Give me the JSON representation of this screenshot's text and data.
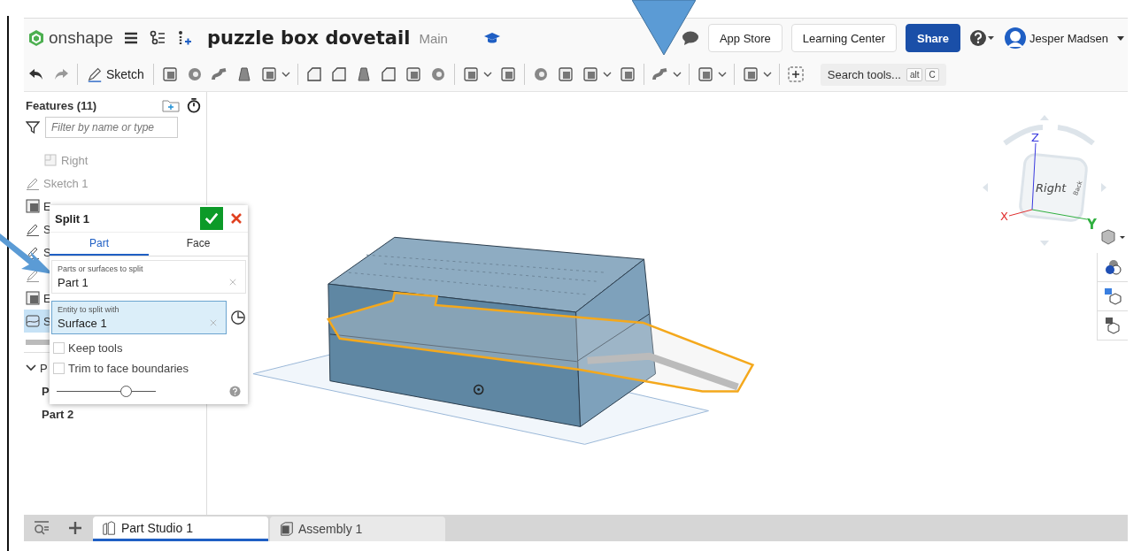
{
  "app": {
    "logo_text": "onshape"
  },
  "document": {
    "title": "puzzle box dovetail",
    "branch": "Main"
  },
  "header_buttons": [
    {
      "label": "App Store",
      "kind": "plain"
    },
    {
      "label": "Learning Center",
      "kind": "plain"
    },
    {
      "label": "Share",
      "kind": "primary"
    }
  ],
  "user": {
    "name": "Jesper Madsen"
  },
  "toolbar": {
    "sketch_label": "Sketch",
    "search": {
      "placeholder": "Search tools...",
      "keys": [
        "alt",
        "C"
      ]
    }
  },
  "features": {
    "title": "Features (11)",
    "filter_placeholder": "Filter by name or type",
    "items": [
      {
        "label": "Right",
        "kind": "plane",
        "hidden": true,
        "selected": false
      },
      {
        "label": "Sketch 1",
        "kind": "sketch",
        "hidden": true,
        "selected": false
      },
      {
        "label": "E",
        "kind": "extrude",
        "hidden": false,
        "selected": false
      },
      {
        "label": "S",
        "kind": "sketch",
        "hidden": false,
        "selected": false
      },
      {
        "label": "S",
        "kind": "sketch",
        "hidden": false,
        "selected": false
      },
      {
        "kind": "sketch",
        "hidden": true,
        "selected": false
      },
      {
        "label": "E",
        "kind": "extrude",
        "hidden": false,
        "selected": false
      },
      {
        "label": "S",
        "kind": "split",
        "hidden": false,
        "selected": true
      }
    ],
    "parts": {
      "label": "P",
      "expanded": true,
      "items": [
        {
          "label": "P"
        },
        {
          "label": "Part 2"
        }
      ]
    }
  },
  "split_dialog": {
    "title": "Split 1",
    "tabs": [
      {
        "label": "Part",
        "selected": true
      },
      {
        "label": "Face",
        "selected": false
      }
    ],
    "fields": [
      {
        "label": "Parts or surfaces to split",
        "value": "Part 1",
        "active": false
      },
      {
        "label": "Entity to split with",
        "value": "Surface 1",
        "active": true
      }
    ],
    "options": [
      {
        "label": "Keep tools",
        "checked": false
      },
      {
        "label": "Trim to face boundaries",
        "checked": false
      }
    ],
    "slider": {
      "level": 0.7
    }
  },
  "viewcube": {
    "faces": [
      "Right",
      "Back"
    ],
    "axes": [
      {
        "label": "Z",
        "color": "#3a3adf"
      },
      {
        "label": "X",
        "color": "#e03030"
      },
      {
        "label": "Y",
        "color": "#30b040"
      }
    ]
  },
  "tabs": [
    {
      "label": "Part Studio 1",
      "kind": "part-studio",
      "selected": true
    },
    {
      "label": "Assembly 1",
      "kind": "assembly",
      "selected": false
    }
  ]
}
